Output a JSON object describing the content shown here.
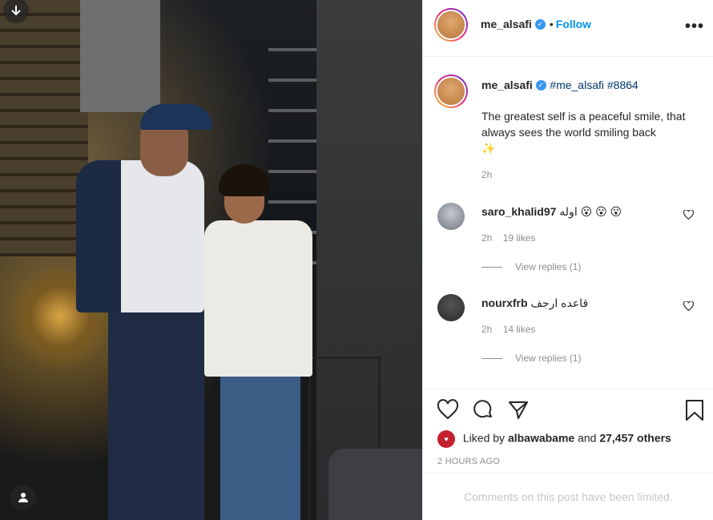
{
  "post": {
    "author": "me_alsafi",
    "follow_label": "Follow",
    "dot": "•",
    "more_label": "•••"
  },
  "caption": {
    "author": "me_alsafi",
    "hashtags": "#me_alsafi #8864",
    "text": "The greatest self is a peaceful smile, that always sees the world smiling back",
    "emoji": "✨",
    "time": "2h"
  },
  "comments": [
    {
      "user": "saro_khalid97",
      "text": "اوله 😮 😮 😮",
      "time": "2h",
      "likes": "19 likes",
      "view_replies": "View replies (1)"
    },
    {
      "user": "nourxfrb",
      "text": "قاعده ارجف",
      "time": "2h",
      "likes": "14 likes",
      "view_replies": "View replies (1)"
    }
  ],
  "likes": {
    "prefix": "Liked by",
    "user": "albawabame",
    "middle": "and",
    "others": "27,457 others"
  },
  "timestamp": "2 HOURS AGO",
  "comments_limited": "Comments on this post have been limited.",
  "colors": {
    "accent": "#0095f6",
    "verified": "#3897f0"
  }
}
